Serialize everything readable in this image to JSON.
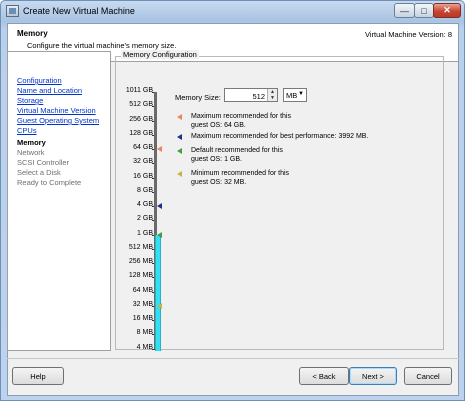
{
  "window": {
    "title": "Create New Virtual Machine"
  },
  "header": {
    "title": "Memory",
    "subtitle": "Configure the virtual machine's memory size.",
    "version": "Virtual Machine Version: 8"
  },
  "nav": {
    "items": [
      {
        "label": "Configuration",
        "state": "link"
      },
      {
        "label": "Name and Location",
        "state": "link"
      },
      {
        "label": "Storage",
        "state": "link"
      },
      {
        "label": "Virtual Machine Version",
        "state": "link"
      },
      {
        "label": "Guest Operating System",
        "state": "link"
      },
      {
        "label": "CPUs",
        "state": "link"
      },
      {
        "label": "Memory",
        "state": "current"
      },
      {
        "label": "Network",
        "state": "disabled"
      },
      {
        "label": "SCSI Controller",
        "state": "disabled"
      },
      {
        "label": "Select a Disk",
        "state": "disabled"
      },
      {
        "label": "Ready to Complete",
        "state": "disabled"
      }
    ]
  },
  "memory": {
    "group_label": "Memory Configuration",
    "size_label": "Memory Size:",
    "size_value": "512",
    "unit_selected": "MB",
    "scale_labels": [
      "1011 GB",
      "512 GB",
      "256 GB",
      "128 GB",
      "64 GB",
      "32 GB",
      "16 GB",
      "8 GB",
      "4 GB",
      "2 GB",
      "1 GB",
      "512 MB",
      "256 MB",
      "128 MB",
      "64 MB",
      "32 MB",
      "16 MB",
      "8 MB",
      "4 MB"
    ],
    "legend": [
      {
        "line1": "Maximum recommended for this",
        "line2": "guest OS: 64 GB.",
        "color": "#e8875f"
      },
      {
        "line1": "Maximum recommended for best performance: 3992 MB.",
        "line2": "",
        "color": "#1f2f8a"
      },
      {
        "line1": "Default recommended for this",
        "line2": "guest OS: 1 GB.",
        "color": "#3f9f3f"
      },
      {
        "line1": "Minimum recommended for this",
        "line2": "guest OS: 32 MB.",
        "color": "#c9b24a"
      }
    ],
    "bar_range_gb": {
      "from": "4 MB",
      "to": "1 GB"
    }
  },
  "buttons": {
    "help": "Help",
    "back": "< Back",
    "next": "Next >",
    "cancel": "Cancel"
  },
  "window_controls": {
    "min": "—",
    "max": "□",
    "close": "✕"
  }
}
